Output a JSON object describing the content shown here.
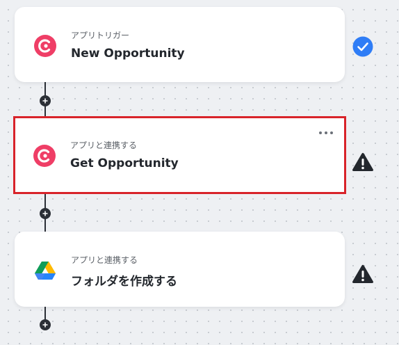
{
  "steps": [
    {
      "kind": "trigger",
      "app_icon": "pink-c-logo-icon",
      "subtitle": "アプリトリガー",
      "title": "New Opportunity",
      "status_icon": "check-circle-icon"
    },
    {
      "kind": "action",
      "app_icon": "pink-c-logo-icon",
      "subtitle": "アプリと連携する",
      "title": "Get Opportunity",
      "status_icon": "warning-icon",
      "selected": true
    },
    {
      "kind": "action",
      "app_icon": "google-drive-icon",
      "subtitle": "アプリと連携する",
      "title": "フォルダを作成する",
      "status_icon": "warning-icon"
    }
  ],
  "colors": {
    "brand_pink": "#ef3e66",
    "check_blue": "#2f7df6",
    "warning_dark": "#23272d",
    "selection_red": "#d8232a",
    "connector": "#2b2f36"
  }
}
